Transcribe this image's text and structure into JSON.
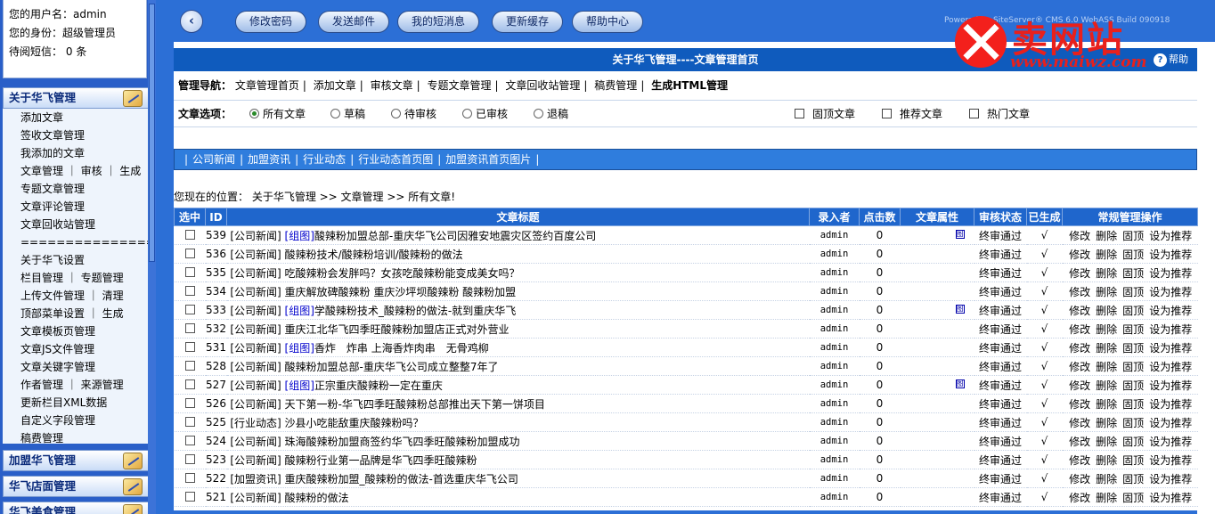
{
  "sidebar": {
    "user": {
      "username_line": "您的用户名：admin",
      "role_line": "您的身份：超级管理员",
      "pending_label": "待阅短信：",
      "pending_count": "0",
      "pending_unit": "条"
    },
    "section1_title": "关于华飞管理",
    "menu_items": [
      "添加文章",
      "签收文章管理",
      "我添加的文章",
      "文章管理 ｜ 审核 ｜ 生成",
      "专题文章管理",
      "文章评论管理",
      "文章回收站管理",
      "====================",
      "关于华飞设置",
      "栏目管理 ｜ 专题管理",
      "上传文件管理 ｜ 清理",
      "顶部菜单设置 ｜ 生成",
      "文章模板页管理",
      "文章JS文件管理",
      "文章关键字管理",
      "作者管理 ｜ 来源管理",
      "更新栏目XML数据",
      "自定义字段管理",
      "稿费管理"
    ],
    "section2_title": "加盟华飞管理",
    "section3_title": "华飞店面管理",
    "section4_title": "华飞美食管理"
  },
  "topbar": {
    "back": "‹",
    "buttons": [
      "修改密码",
      "发送邮件",
      "我的短消息",
      "更新缓存",
      "帮助中心"
    ],
    "powered": "Powered by SiteServer® CMS 6.0 WebASS Build 090918"
  },
  "watermark": {
    "cn": "卖网站",
    "en": "www.maiwz.com"
  },
  "content": {
    "title": "关于华飞管理----文章管理首页",
    "help": "帮助",
    "nav_label": "管理导航：",
    "nav_links": [
      "文章管理首页",
      "添加文章",
      "审核文章",
      "专题文章管理",
      "文章回收站管理",
      "稿费管理",
      "生成HTML管理"
    ],
    "options_label": "文章选项：",
    "radio_options": [
      "所有文章",
      "草稿",
      "待审核",
      "已审核",
      "退稿"
    ],
    "selected_radio": "所有文章",
    "checkbox_options": [
      "固顶文章",
      "推荐文章",
      "热门文章"
    ],
    "categories": [
      "公司新闻",
      "加盟资讯",
      "行业动态",
      "行业动态首页图",
      "加盟资讯首页图片"
    ],
    "breadcrumb": "您现在的位置： 关于华飞管理 >> 文章管理 >> 所有文章!"
  },
  "table": {
    "headers": [
      "选中",
      "ID",
      "文章标题",
      "录入者",
      "点击数",
      "文章属性",
      "审核状态",
      "已生成",
      "常规管理操作"
    ],
    "ops": [
      "修改",
      "删除",
      "固顶",
      "设为推荐"
    ],
    "rows": [
      {
        "id": "539",
        "cat": "[公司新闻]",
        "grp": "[组图]",
        "title": "酸辣粉加盟总部-重庆华飞公司因雅安地震灾区签约百度公司",
        "author": "admin",
        "clicks": "0",
        "attr": "图",
        "status": "终审通过",
        "gen": "√"
      },
      {
        "id": "536",
        "cat": "[公司新闻]",
        "grp": "",
        "title": "酸辣粉技术/酸辣粉培训/酸辣粉的做法",
        "author": "admin",
        "clicks": "0",
        "attr": "",
        "status": "终审通过",
        "gen": "√"
      },
      {
        "id": "535",
        "cat": "[公司新闻]",
        "grp": "",
        "title": "吃酸辣粉会发胖吗？女孩吃酸辣粉能变成美女吗？",
        "author": "admin",
        "clicks": "0",
        "attr": "",
        "status": "终审通过",
        "gen": "√"
      },
      {
        "id": "534",
        "cat": "[公司新闻]",
        "grp": "",
        "title": "重庆解放碑酸辣粉 重庆沙坪坝酸辣粉 酸辣粉加盟",
        "author": "admin",
        "clicks": "0",
        "attr": "",
        "status": "终审通过",
        "gen": "√"
      },
      {
        "id": "533",
        "cat": "[公司新闻]",
        "grp": "[组图]",
        "title": "学酸辣粉技术_酸辣粉的做法-就到重庆华飞",
        "author": "admin",
        "clicks": "0",
        "attr": "图",
        "status": "终审通过",
        "gen": "√"
      },
      {
        "id": "532",
        "cat": "[公司新闻]",
        "grp": "",
        "title": "重庆江北华飞四季旺酸辣粉加盟店正式对外营业",
        "author": "admin",
        "clicks": "0",
        "attr": "",
        "status": "终审通过",
        "gen": "√"
      },
      {
        "id": "531",
        "cat": "[公司新闻]",
        "grp": "[组图]",
        "title": "香炸　炸串 上海香炸肉串　无骨鸡柳",
        "author": "admin",
        "clicks": "0",
        "attr": "",
        "status": "终审通过",
        "gen": "√"
      },
      {
        "id": "528",
        "cat": "[公司新闻]",
        "grp": "",
        "title": "酸辣粉加盟总部-重庆华飞公司成立整整7年了",
        "author": "admin",
        "clicks": "0",
        "attr": "",
        "status": "终审通过",
        "gen": "√"
      },
      {
        "id": "527",
        "cat": "[公司新闻]",
        "grp": "[组图]",
        "title": "正宗重庆酸辣粉一定在重庆",
        "author": "admin",
        "clicks": "0",
        "attr": "图",
        "status": "终审通过",
        "gen": "√"
      },
      {
        "id": "526",
        "cat": "[公司新闻]",
        "grp": "",
        "title": "天下第一粉-华飞四季旺酸辣粉总部推出天下第一饼项目",
        "author": "admin",
        "clicks": "0",
        "attr": "",
        "status": "终审通过",
        "gen": "√"
      },
      {
        "id": "525",
        "cat": "[行业动态]",
        "grp": "",
        "title": "沙县小吃能敌重庆酸辣粉吗？",
        "author": "admin",
        "clicks": "0",
        "attr": "",
        "status": "终审通过",
        "gen": "√"
      },
      {
        "id": "524",
        "cat": "[公司新闻]",
        "grp": "",
        "title": "珠海酸辣粉加盟商签约华飞四季旺酸辣粉加盟成功",
        "author": "admin",
        "clicks": "0",
        "attr": "",
        "status": "终审通过",
        "gen": "√"
      },
      {
        "id": "523",
        "cat": "[公司新闻]",
        "grp": "",
        "title": "酸辣粉行业第一品牌是华飞四季旺酸辣粉",
        "author": "admin",
        "clicks": "0",
        "attr": "",
        "status": "终审通过",
        "gen": "√"
      },
      {
        "id": "522",
        "cat": "[加盟资讯]",
        "grp": "",
        "title": "重庆酸辣粉加盟_酸辣粉的做法-首选重庆华飞公司",
        "author": "admin",
        "clicks": "0",
        "attr": "",
        "status": "终审通过",
        "gen": "√"
      },
      {
        "id": "521",
        "cat": "[公司新闻]",
        "grp": "",
        "title": "酸辣粉的做法",
        "author": "admin",
        "clicks": "0",
        "attr": "",
        "status": "终审通过",
        "gen": "√"
      }
    ]
  }
}
